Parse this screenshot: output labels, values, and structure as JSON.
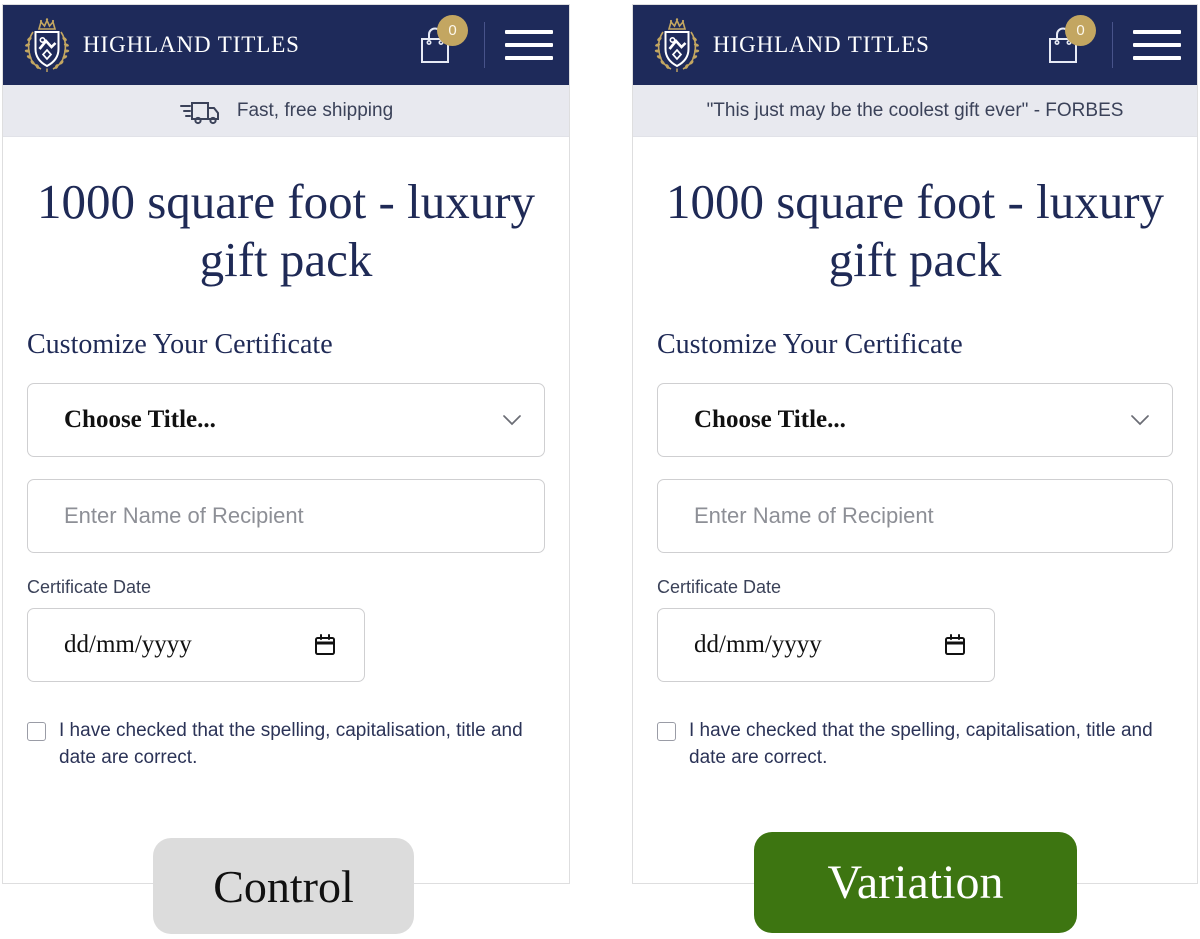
{
  "colors": {
    "navy": "#1e2a5a",
    "gold": "#c3a661",
    "announce_bg": "#e8e9ef",
    "control_badge_bg": "#dcdcdc",
    "variation_badge_bg": "#3d7511",
    "title_text": "#1f2a56"
  },
  "brand": {
    "name": "HIGHLAND TITLES",
    "crest_icon": "shield-crest-icon"
  },
  "header": {
    "cart_icon": "shopping-bag-icon",
    "cart_count": "0",
    "menu_icon": "hamburger-menu-icon"
  },
  "variants": [
    {
      "id": "control",
      "badge_label": "Control",
      "announcement": {
        "icon": "delivery-truck-icon",
        "has_icon": true,
        "text": "Fast, free shipping"
      }
    },
    {
      "id": "variation",
      "badge_label": "Variation",
      "announcement": {
        "icon": "",
        "has_icon": false,
        "text": "\"This just may be the coolest gift ever\" - FORBES"
      }
    }
  ],
  "product": {
    "title": "1000 square foot - luxury gift pack",
    "section_heading": "Customize Your Certificate",
    "title_select": {
      "value": "Choose Title...",
      "chevron_icon": "chevron-down-icon"
    },
    "recipient_input": {
      "value": "",
      "placeholder": "Enter Name of Recipient"
    },
    "date_field": {
      "label": "Certificate Date",
      "value": "",
      "placeholder": "dd/mm/yyyy",
      "calendar_icon": "calendar-icon"
    },
    "confirm_checkbox": {
      "checked": false,
      "label": "I have checked that the spelling, capitalisation, title and date are correct."
    }
  }
}
